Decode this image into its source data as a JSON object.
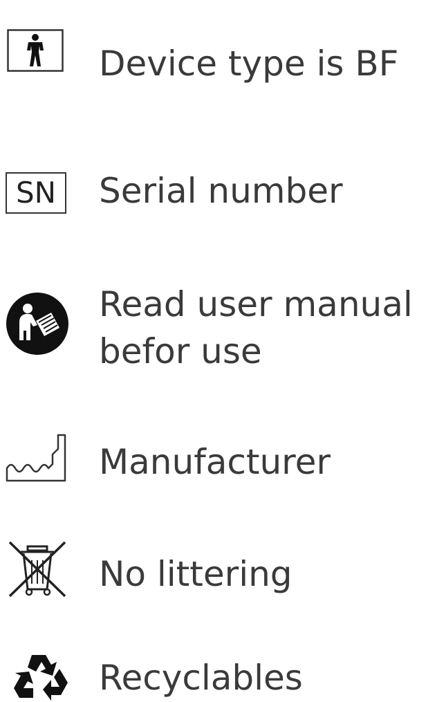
{
  "symbols": [
    {
      "icon": "bf-body-icon",
      "label": "Device type is BF"
    },
    {
      "icon": "sn-icon",
      "label": "Serial number",
      "icon_text": "SN"
    },
    {
      "icon": "read-manual-icon",
      "label_lines": [
        "Read user manual",
        "befor use"
      ]
    },
    {
      "icon": "manufacturer-icon",
      "label": "Manufacturer"
    },
    {
      "icon": "no-littering-icon",
      "label": "No littering"
    },
    {
      "icon": "recycle-icon",
      "label": "Recyclables"
    }
  ]
}
